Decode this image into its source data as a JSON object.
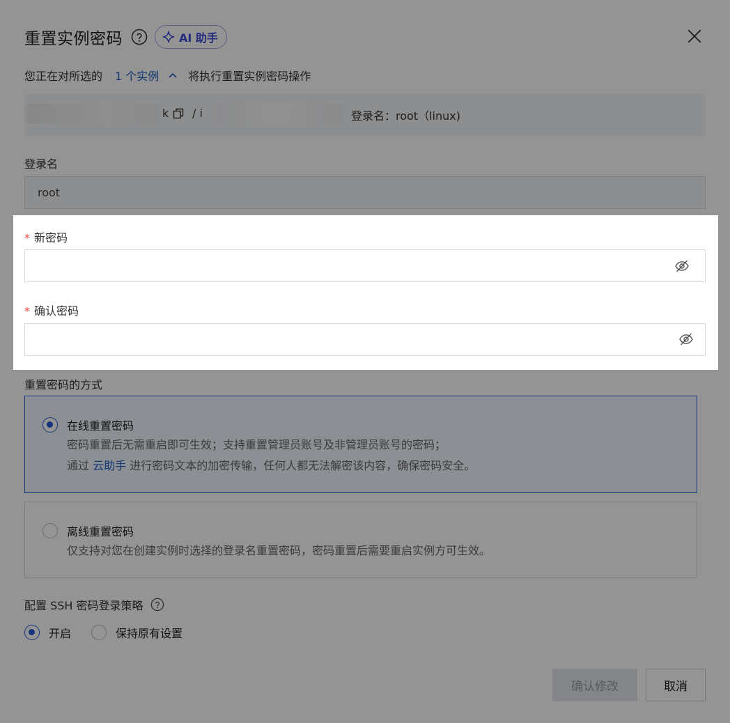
{
  "dialog": {
    "title": "重置实例密码",
    "ai_assistant_label": "AI 助手"
  },
  "subline": {
    "prefix": "您正在对所选的",
    "instance_count_link": "1 个实例",
    "suffix": "将执行重置实例密码操作"
  },
  "instance": {
    "id_tail": "k",
    "separator": "/ i",
    "login_info": "登录名：root（linux)"
  },
  "login_name": {
    "label": "登录名",
    "value": "root"
  },
  "new_password": {
    "label": "新密码",
    "value": ""
  },
  "confirm_password": {
    "label": "确认密码",
    "value": ""
  },
  "reset_method": {
    "label": "重置密码的方式",
    "online": {
      "title": "在线重置密码",
      "desc_line1": "密码重置后无需重启即可生效；支持重置管理员账号及非管理员账号的密码；",
      "desc_line2_prefix": "通过",
      "desc_line2_link": "云助手",
      "desc_line2_suffix": "进行密码文本的加密传输，任何人都无法解密该内容，确保密码安全。",
      "selected": true
    },
    "offline": {
      "title": "离线重置密码",
      "desc": "仅支持对您在创建实例时选择的登录名重置密码，密码重置后需要重启实例方可生效。",
      "selected": false
    }
  },
  "ssh_policy": {
    "label": "配置 SSH 密码登录策略",
    "option_on": "开启",
    "option_keep": "保持原有设置",
    "selected": "开启"
  },
  "footer": {
    "confirm_label": "确认修改",
    "cancel_label": "取消"
  },
  "colors": {
    "primary": "#2a5bd7",
    "link": "#1d5fc2",
    "required": "#e34d3d",
    "ai_accent": "#3c4bd6"
  }
}
